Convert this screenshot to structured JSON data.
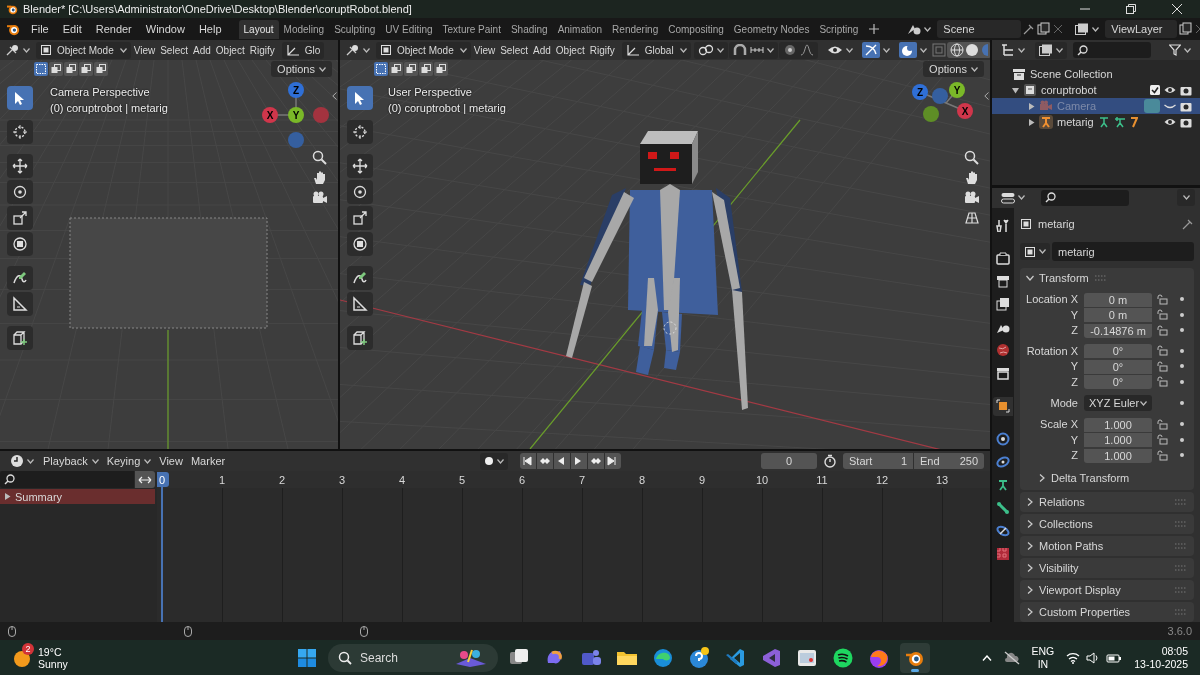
{
  "window": {
    "title": "Blender* [C:\\Users\\Administrator\\OneDrive\\Desktop\\Blender\\coruptRobot.blend]"
  },
  "menu": [
    "File",
    "Edit",
    "Render",
    "Window",
    "Help"
  ],
  "workspaces": [
    {
      "label": "Layout",
      "selected": true
    },
    {
      "label": "Modeling",
      "selected": false
    },
    {
      "label": "Sculpting",
      "selected": false
    },
    {
      "label": "UV Editing",
      "selected": false
    },
    {
      "label": "Texture Paint",
      "selected": false
    },
    {
      "label": "Shading",
      "selected": false
    },
    {
      "label": "Animation",
      "selected": false
    },
    {
      "label": "Rendering",
      "selected": false
    },
    {
      "label": "Compositing",
      "selected": false
    },
    {
      "label": "Geometry Nodes",
      "selected": false
    },
    {
      "label": "Scripting",
      "selected": false
    }
  ],
  "scene": {
    "name": "Scene"
  },
  "view_layer": {
    "name": "ViewLayer"
  },
  "viewports": [
    {
      "kind": "camera",
      "mode": "Object Mode",
      "menus": [
        "View",
        "Select",
        "Add",
        "Object",
        "Rigify"
      ],
      "orientation": "Glo",
      "options": "Options",
      "title": "Camera Perspective",
      "subtitle": "(0) coruptrobot | metarig",
      "gizmo": {
        "x": "X",
        "y": "Y",
        "z": "Z"
      }
    },
    {
      "kind": "user",
      "mode": "Object Mode",
      "menus": [
        "View",
        "Select",
        "Add",
        "Object",
        "Rigify"
      ],
      "orientation": "Global",
      "options": "Options",
      "title": "User Perspective",
      "subtitle": "(0) coruptrobot | metarig",
      "gizmo": {
        "x": "X",
        "y": "Y",
        "z": "Z"
      }
    }
  ],
  "outliner": {
    "root": "Scene Collection",
    "items": [
      {
        "label": "coruptrobot",
        "kind": "collection",
        "selected": false,
        "expanded": true,
        "checked": true,
        "visible": true,
        "children": [
          {
            "label": "Camera",
            "kind": "camera",
            "selected": true,
            "expanded": false,
            "visible": false
          },
          {
            "label": "metarig",
            "kind": "armature",
            "selected": false,
            "expanded": false,
            "visible": true
          }
        ]
      }
    ]
  },
  "properties": {
    "tabs": [
      {
        "kind": "tool",
        "selected": false
      },
      {
        "kind": "render",
        "selected": false
      },
      {
        "kind": "output",
        "selected": false
      },
      {
        "kind": "view_layer",
        "selected": false
      },
      {
        "kind": "scene",
        "selected": false
      },
      {
        "kind": "world",
        "selected": false
      },
      {
        "kind": "collection",
        "selected": false
      },
      {
        "kind": "object",
        "selected": true
      },
      {
        "kind": "physics",
        "selected": false
      },
      {
        "kind": "constraints",
        "selected": false
      },
      {
        "kind": "armature",
        "selected": false
      },
      {
        "kind": "bone",
        "selected": false
      },
      {
        "kind": "bone_constraint",
        "selected": false
      },
      {
        "kind": "texture",
        "selected": false
      }
    ],
    "object": "metarig",
    "data": "metarig",
    "transform": {
      "title": "Transform",
      "expanded": true,
      "groups": [
        {
          "rows": [
            {
              "kind": "field",
              "label": "Location X",
              "value": "0 m"
            },
            {
              "kind": "field",
              "label": "Y",
              "value": "0 m"
            },
            {
              "kind": "field",
              "label": "Z",
              "value": "-0.14876 m"
            }
          ]
        },
        {
          "rows": [
            {
              "kind": "field",
              "label": "Rotation X",
              "value": "0°"
            },
            {
              "kind": "field",
              "label": "Y",
              "value": "0°"
            },
            {
              "kind": "field",
              "label": "Z",
              "value": "0°"
            }
          ]
        },
        {
          "rows": [
            {
              "kind": "dropdown",
              "label": "Mode",
              "value": "XYZ Euler"
            }
          ]
        },
        {
          "rows": [
            {
              "kind": "field",
              "label": "Scale X",
              "value": "1.000"
            },
            {
              "kind": "field",
              "label": "Y",
              "value": "1.000"
            },
            {
              "kind": "field",
              "label": "Z",
              "value": "1.000"
            }
          ]
        }
      ],
      "subpanels": [
        {
          "title": "Delta Transform",
          "expanded": false
        }
      ]
    },
    "panels": [
      {
        "title": "Relations",
        "expanded": false
      },
      {
        "title": "Collections",
        "expanded": false
      },
      {
        "title": "Motion Paths",
        "expanded": false
      },
      {
        "title": "Visibility",
        "expanded": false
      },
      {
        "title": "Viewport Display",
        "expanded": false
      },
      {
        "title": "Custom Properties",
        "expanded": false
      }
    ]
  },
  "timeline": {
    "menus": [
      {
        "label": "Playback",
        "dropdown": true
      },
      {
        "label": "Keying",
        "dropdown": true
      },
      {
        "label": "View",
        "dropdown": false
      },
      {
        "label": "Marker",
        "dropdown": false
      }
    ],
    "current_frame": "0",
    "start_label": "Start",
    "start": "1",
    "end_label": "End",
    "end": "250",
    "playhead": "0",
    "ruler": [
      "1",
      "2",
      "3",
      "4",
      "5",
      "6",
      "7",
      "8",
      "9",
      "10",
      "11",
      "12",
      "13"
    ],
    "channels": [
      {
        "label": "Summary",
        "expanded": false
      }
    ]
  },
  "status_bar": {
    "version": "3.6.0"
  },
  "taskbar": {
    "weather": {
      "badge": "2",
      "temperature": "19°C",
      "condition": "Sunny"
    },
    "search": "Search",
    "apps": [
      {
        "kind": "task_view",
        "selected": false
      },
      {
        "kind": "copilot",
        "selected": false
      },
      {
        "kind": "teams",
        "selected": false
      },
      {
        "kind": "explorer",
        "selected": false
      },
      {
        "kind": "edge",
        "selected": false
      },
      {
        "kind": "help",
        "selected": false
      },
      {
        "kind": "vscode",
        "selected": false
      },
      {
        "kind": "visual_studio",
        "selected": false
      },
      {
        "kind": "window_app",
        "selected": false
      },
      {
        "kind": "spotify",
        "selected": false
      },
      {
        "kind": "firefox",
        "selected": false
      },
      {
        "kind": "blender",
        "selected": true
      }
    ],
    "language": "ENG",
    "region": "IN",
    "time": "08:05",
    "date": "13-10-2025"
  }
}
